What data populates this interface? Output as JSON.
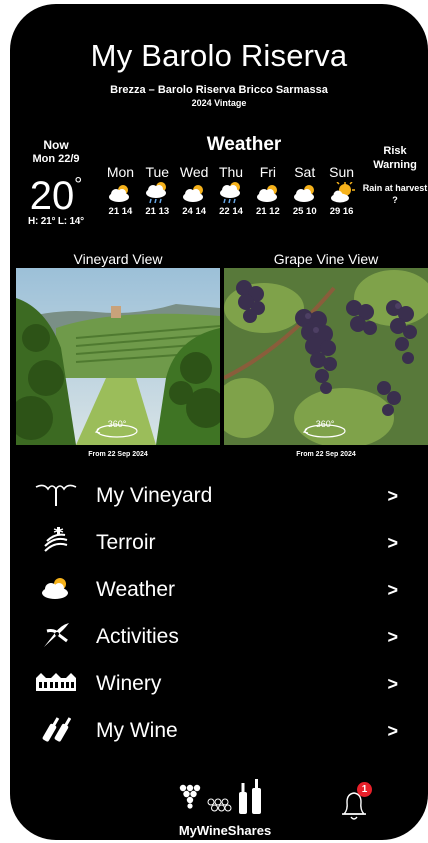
{
  "header": {
    "title": "My Barolo Riserva",
    "subtitle": "Brezza – Barolo Riserva Bricco Sarmassa",
    "vintage": "2024 Vintage"
  },
  "weather": {
    "now_label": "Now",
    "now_date": "Mon 22/9",
    "now_temp": "20",
    "now_unit": "°",
    "now_hl": "H: 21°  L: 14°",
    "title": "Weather",
    "days": [
      {
        "name": "Mon",
        "icon": "cloud-sun-icon",
        "temps": "21 14"
      },
      {
        "name": "Tue",
        "icon": "cloud-rain-icon",
        "temps": "21 13"
      },
      {
        "name": "Wed",
        "icon": "cloud-icon",
        "temps": "24 14"
      },
      {
        "name": "Thu",
        "icon": "cloud-rain-icon",
        "temps": "22 14"
      },
      {
        "name": "Fri",
        "icon": "cloud-icon",
        "temps": "21 12"
      },
      {
        "name": "Sat",
        "icon": "cloud-icon",
        "temps": "25 10"
      },
      {
        "name": "Sun",
        "icon": "sun-cloud-icon",
        "temps": "29 16"
      }
    ],
    "risk_title": "Risk Warning",
    "risk_text": "Rain at harvest ?"
  },
  "views": {
    "vineyard_label": "Vineyard View",
    "vineyard_caption": "From 22 Sep 2024",
    "vineyard_badge": "360°",
    "grape_label": "Grape Vine View",
    "grape_caption": "From 22 Sep 2024",
    "grape_badge": "360°"
  },
  "menu": [
    {
      "label": "My Vineyard",
      "icon": "vine-icon",
      "arrow": ">"
    },
    {
      "label": "Terroir",
      "icon": "terroir-icon",
      "arrow": ">"
    },
    {
      "label": "Weather",
      "icon": "cloud-icon",
      "arrow": ">"
    },
    {
      "label": "Activities",
      "icon": "pruning-shears-icon",
      "arrow": ">"
    },
    {
      "label": "Winery",
      "icon": "winery-building-icon",
      "arrow": ">"
    },
    {
      "label": "My Wine",
      "icon": "wine-bottles-icon",
      "arrow": ">"
    }
  ],
  "footer": {
    "brand": "MyWineShares",
    "notification_count": "1"
  },
  "colors": {
    "background": "#000000",
    "text": "#ffffff",
    "badge": "#e8202a",
    "sun": "#f6b21b"
  }
}
